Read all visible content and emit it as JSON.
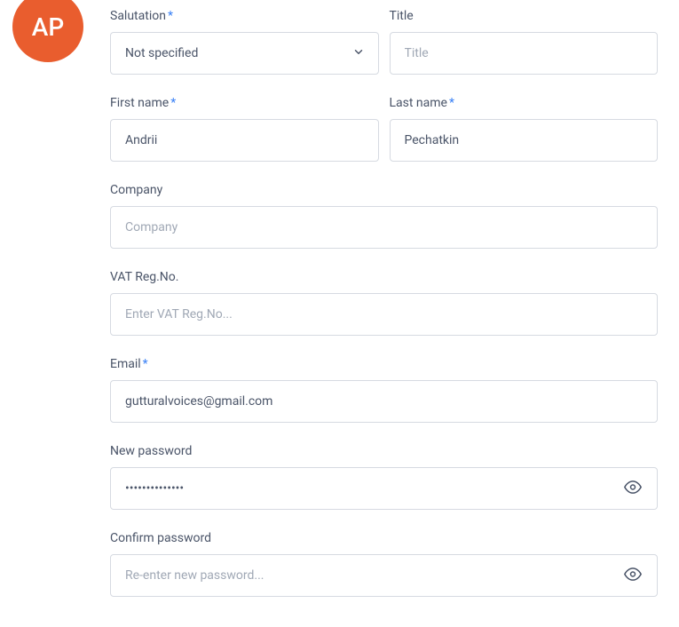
{
  "avatar": {
    "initials": "AP"
  },
  "form": {
    "salutation": {
      "label": "Salutation",
      "value": "Not specified"
    },
    "title": {
      "label": "Title",
      "placeholder": "Title",
      "value": ""
    },
    "first_name": {
      "label": "First name",
      "value": "Andrii"
    },
    "last_name": {
      "label": "Last name",
      "value": "Pechatkin"
    },
    "company": {
      "label": "Company",
      "placeholder": "Company",
      "value": ""
    },
    "vat": {
      "label": "VAT Reg.No.",
      "placeholder": "Enter VAT Reg.No...",
      "value": ""
    },
    "email": {
      "label": "Email",
      "value": "gutturalvoices@gmail.com"
    },
    "new_password": {
      "label": "New password",
      "value": "••••••••••••••"
    },
    "confirm_password": {
      "label": "Confirm password",
      "placeholder": "Re-enter new password...",
      "value": ""
    }
  },
  "required_mark": "*"
}
